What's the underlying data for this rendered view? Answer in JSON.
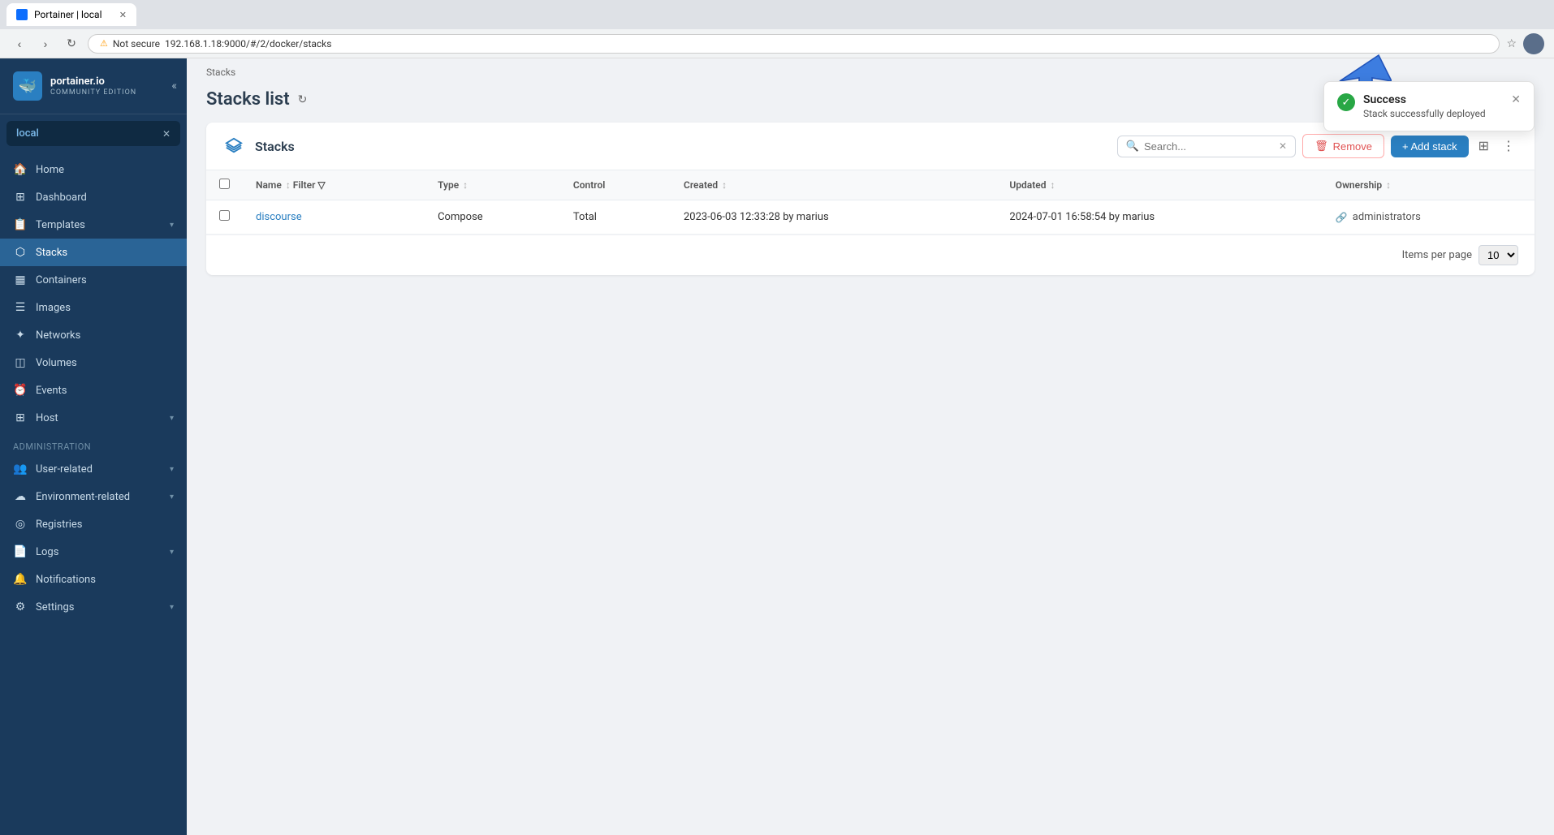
{
  "browser": {
    "tab_title": "Portainer | local",
    "url": "192.168.1.18:9000/#/2/docker/stacks",
    "not_secure_label": "Not secure"
  },
  "sidebar": {
    "logo_text": "portainer.io",
    "logo_sub": "COMMUNITY EDITION",
    "env_name": "local",
    "nav_items": [
      {
        "id": "home",
        "label": "Home",
        "icon": "🏠"
      },
      {
        "id": "dashboard",
        "label": "Dashboard",
        "icon": "⊞"
      },
      {
        "id": "templates",
        "label": "Templates",
        "icon": "📋",
        "has_chevron": true
      },
      {
        "id": "stacks",
        "label": "Stacks",
        "icon": "⬡",
        "active": true
      },
      {
        "id": "containers",
        "label": "Containers",
        "icon": "▦"
      },
      {
        "id": "images",
        "label": "Images",
        "icon": "☰"
      },
      {
        "id": "networks",
        "label": "Networks",
        "icon": "✦"
      },
      {
        "id": "volumes",
        "label": "Volumes",
        "icon": "◫"
      },
      {
        "id": "events",
        "label": "Events",
        "icon": "⏰"
      },
      {
        "id": "host",
        "label": "Host",
        "icon": "⊞",
        "has_chevron": true
      }
    ],
    "admin_section": "Administration",
    "admin_items": [
      {
        "id": "user-related",
        "label": "User-related",
        "icon": "👥",
        "has_chevron": true
      },
      {
        "id": "environment-related",
        "label": "Environment-related",
        "icon": "☁",
        "has_chevron": true
      },
      {
        "id": "registries",
        "label": "Registries",
        "icon": "◎"
      },
      {
        "id": "logs",
        "label": "Logs",
        "icon": "📄",
        "has_chevron": true
      },
      {
        "id": "notifications",
        "label": "Notifications",
        "icon": "🔔"
      },
      {
        "id": "settings",
        "label": "Settings",
        "icon": "⚙",
        "has_chevron": true
      }
    ]
  },
  "breadcrumb": "Stacks",
  "page_title": "Stacks list",
  "panel": {
    "title": "Stacks",
    "search_placeholder": "Search...",
    "remove_label": "Remove",
    "add_stack_label": "+ Add stack",
    "items_per_page_label": "Items per page",
    "items_per_page_value": "10",
    "columns": [
      {
        "id": "name",
        "label": "Name"
      },
      {
        "id": "type",
        "label": "Type"
      },
      {
        "id": "control",
        "label": "Control"
      },
      {
        "id": "created",
        "label": "Created"
      },
      {
        "id": "updated",
        "label": "Updated"
      },
      {
        "id": "ownership",
        "label": "Ownership"
      }
    ],
    "rows": [
      {
        "name": "discourse",
        "type": "Compose",
        "control": "Total",
        "created": "2023-06-03 12:33:28 by marius",
        "updated": "2024-07-01 16:58:54 by marius",
        "ownership": "administrators"
      }
    ]
  },
  "notification": {
    "title": "Success",
    "message": "Stack successfully deployed"
  }
}
